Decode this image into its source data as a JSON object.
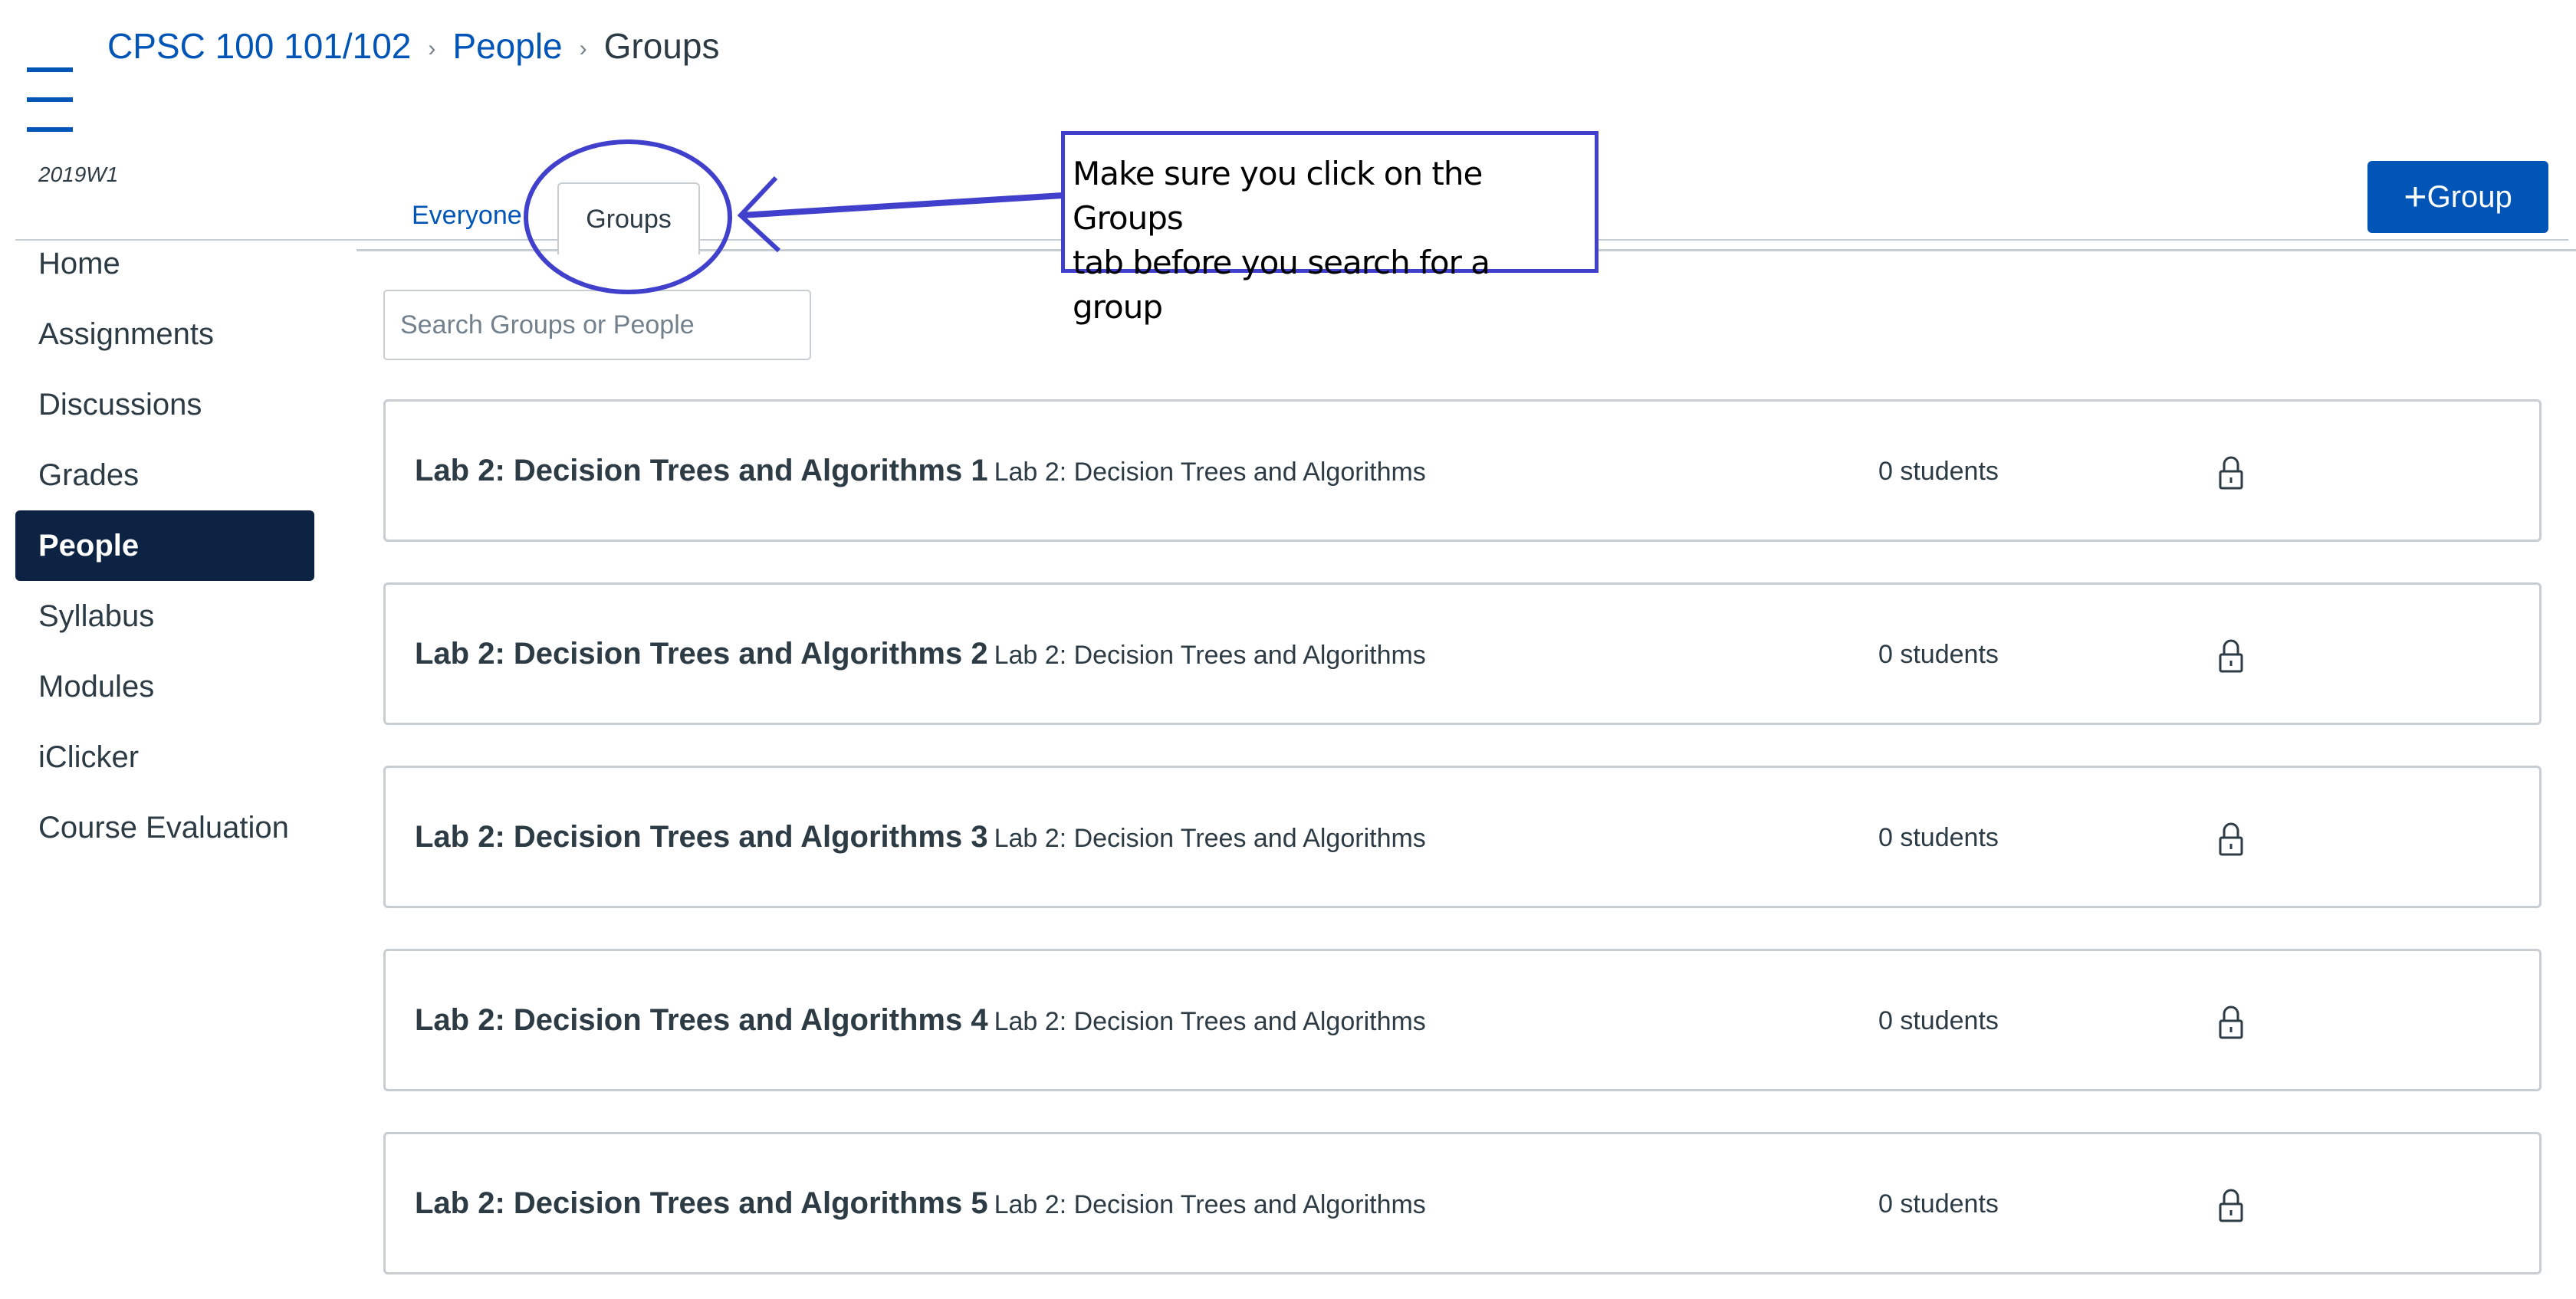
{
  "breadcrumb": {
    "course": "CPSC 100 101/102",
    "section": "People",
    "current": "Groups"
  },
  "sidebar": {
    "term": "2019W1",
    "items": [
      {
        "label": "Home"
      },
      {
        "label": "Assignments"
      },
      {
        "label": "Discussions"
      },
      {
        "label": "Grades"
      },
      {
        "label": "People",
        "active": true
      },
      {
        "label": "Syllabus"
      },
      {
        "label": "Modules"
      },
      {
        "label": "iClicker"
      },
      {
        "label": "Course Evaluation"
      }
    ]
  },
  "tabs": {
    "everyone": "Everyone",
    "groups": "Groups"
  },
  "add_group_button": {
    "icon": "plus-icon",
    "label": "Group"
  },
  "search": {
    "placeholder": "Search Groups or People",
    "value": ""
  },
  "groups": [
    {
      "name": "Lab 2: Decision Trees and Algorithms 1",
      "category": "Lab 2: Decision Trees and Algorithms",
      "count": "0 students",
      "icon": "lock-icon"
    },
    {
      "name": "Lab 2: Decision Trees and Algorithms 2",
      "category": "Lab 2: Decision Trees and Algorithms",
      "count": "0 students",
      "icon": "lock-icon"
    },
    {
      "name": "Lab 2: Decision Trees and Algorithms 3",
      "category": "Lab 2: Decision Trees and Algorithms",
      "count": "0 students",
      "icon": "lock-icon"
    },
    {
      "name": "Lab 2: Decision Trees and Algorithms 4",
      "category": "Lab 2: Decision Trees and Algorithms",
      "count": "0 students",
      "icon": "lock-icon"
    },
    {
      "name": "Lab 2: Decision Trees and Algorithms 5",
      "category": "Lab 2: Decision Trees and Algorithms",
      "count": "0 students",
      "icon": "lock-icon"
    }
  ],
  "annotation": {
    "line1": "Make sure you click on the Groups",
    "line2": "tab before you search for a group",
    "color": "#4040cc"
  },
  "colors": {
    "brand": "#0055b7",
    "nav_active": "#0c2343",
    "border": "#c7cdd1"
  }
}
